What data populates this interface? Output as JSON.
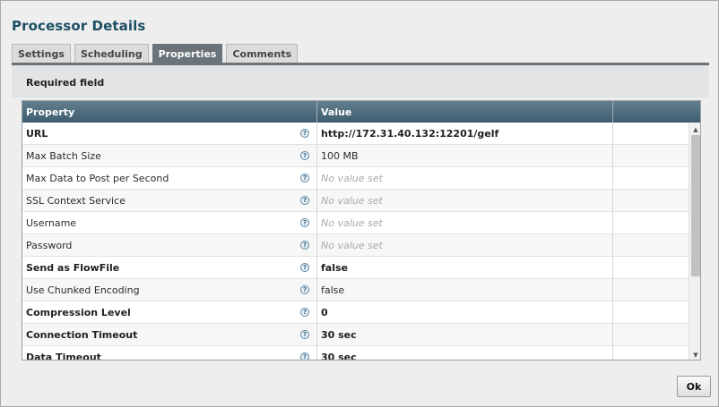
{
  "dialog": {
    "title": "Processor Details"
  },
  "tabs": [
    {
      "label": "Settings",
      "active": false
    },
    {
      "label": "Scheduling",
      "active": false
    },
    {
      "label": "Properties",
      "active": true
    },
    {
      "label": "Comments",
      "active": false
    }
  ],
  "required_field_label": "Required field",
  "grid": {
    "columns": [
      "Property",
      "Value",
      ""
    ],
    "help_icon": "?",
    "rows": [
      {
        "property": "URL",
        "required": true,
        "value": "http://172.31.40.132:12201/gelf",
        "set": true
      },
      {
        "property": "Max Batch Size",
        "required": false,
        "value": "100 MB",
        "set": true
      },
      {
        "property": "Max Data to Post per Second",
        "required": false,
        "value": "No value set",
        "set": false
      },
      {
        "property": "SSL Context Service",
        "required": false,
        "value": "No value set",
        "set": false
      },
      {
        "property": "Username",
        "required": false,
        "value": "No value set",
        "set": false
      },
      {
        "property": "Password",
        "required": false,
        "value": "No value set",
        "set": false
      },
      {
        "property": "Send as FlowFile",
        "required": true,
        "value": "false",
        "set": true
      },
      {
        "property": "Use Chunked Encoding",
        "required": false,
        "value": "false",
        "set": true
      },
      {
        "property": "Compression Level",
        "required": true,
        "value": "0",
        "set": true
      },
      {
        "property": "Connection Timeout",
        "required": true,
        "value": "30 sec",
        "set": true
      },
      {
        "property": "Data Timeout",
        "required": true,
        "value": "30 sec",
        "set": true
      }
    ],
    "scrollbar": {
      "up_icon": "▲",
      "down_icon": "▼"
    }
  },
  "ok_button": {
    "label": "Ok"
  }
}
